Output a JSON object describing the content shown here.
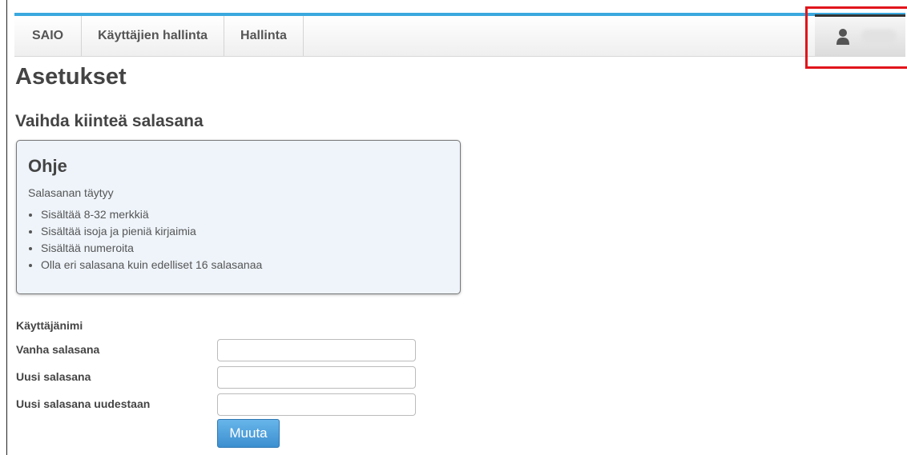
{
  "nav": {
    "items": [
      {
        "label": "SAIO"
      },
      {
        "label": "Käyttäjien hallinta"
      },
      {
        "label": "Hallinta"
      }
    ],
    "user_icon": "user-icon"
  },
  "page": {
    "title": "Asetukset",
    "section_title": "Vaihda kiinteä salasana"
  },
  "help": {
    "title": "Ohje",
    "intro": "Salasanan täytyy",
    "rules": [
      "Sisältää 8-32 merkkiä",
      "Sisältää isoja ja pieniä kirjaimia",
      "Sisältää numeroita",
      "Olla eri salasana kuin edelliset 16 salasanaa"
    ]
  },
  "form": {
    "username_label": "Käyttäjänimi",
    "old_password_label": "Vanha salasana",
    "new_password_label": "Uusi salasana",
    "new_password_again_label": "Uusi salasana uudestaan",
    "old_password_value": "",
    "new_password_value": "",
    "new_password_again_value": "",
    "submit_label": "Muuta"
  },
  "colors": {
    "accent": "#3aa8de",
    "highlight": "#e0151b",
    "button": "#4a9ad8"
  }
}
